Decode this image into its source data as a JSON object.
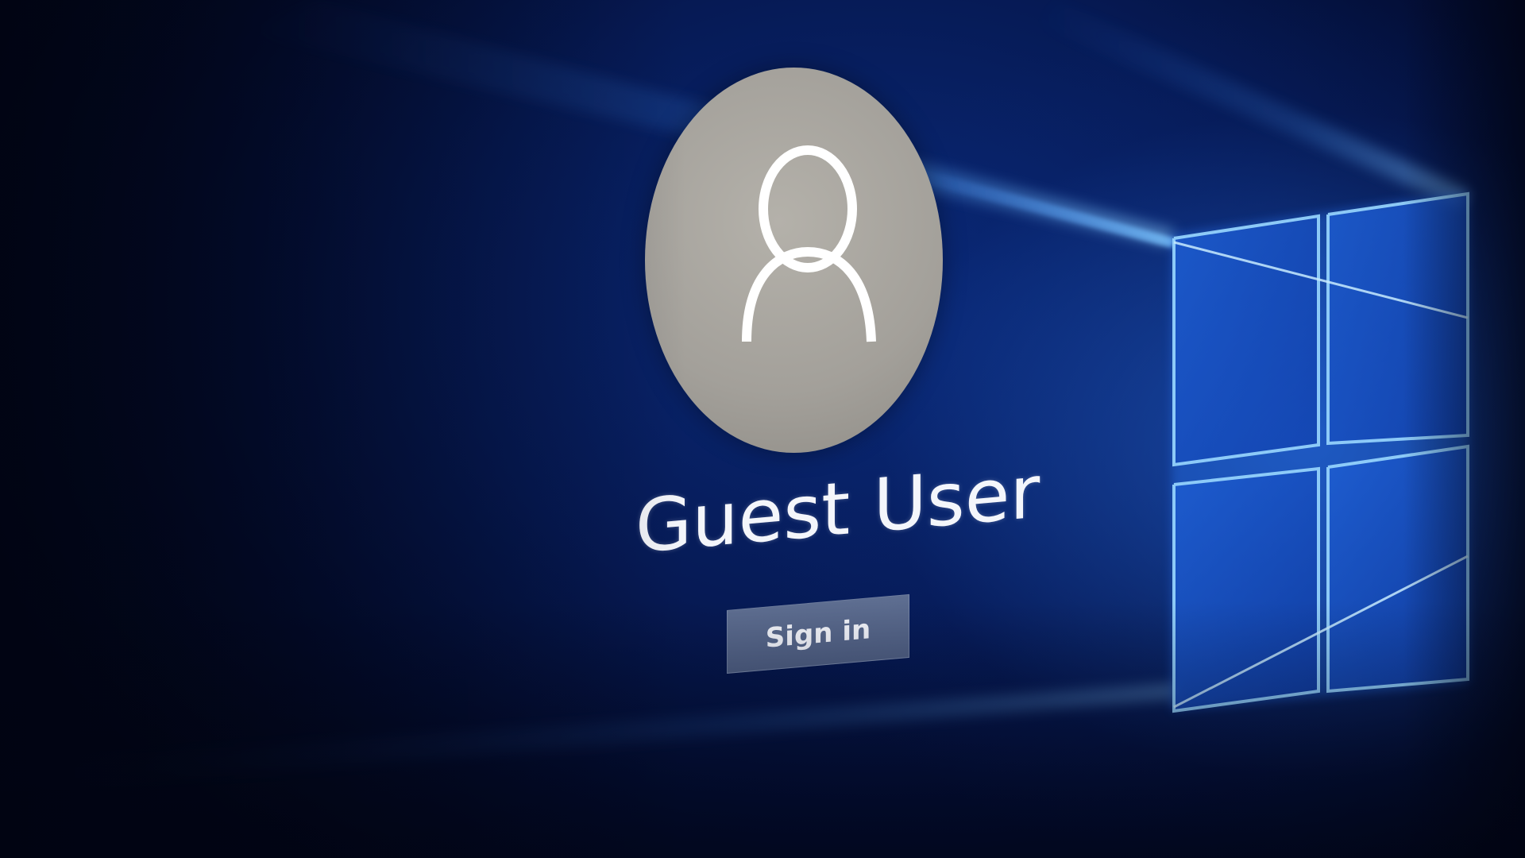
{
  "lock_screen": {
    "user": {
      "name": "Guest User",
      "avatar_icon": "user-silhouette-icon"
    },
    "sign_in_label": "Sign in",
    "background": {
      "logo": "windows-logo-icon",
      "accent_color": "#1f6fe8",
      "base_color": "#061a55"
    }
  }
}
